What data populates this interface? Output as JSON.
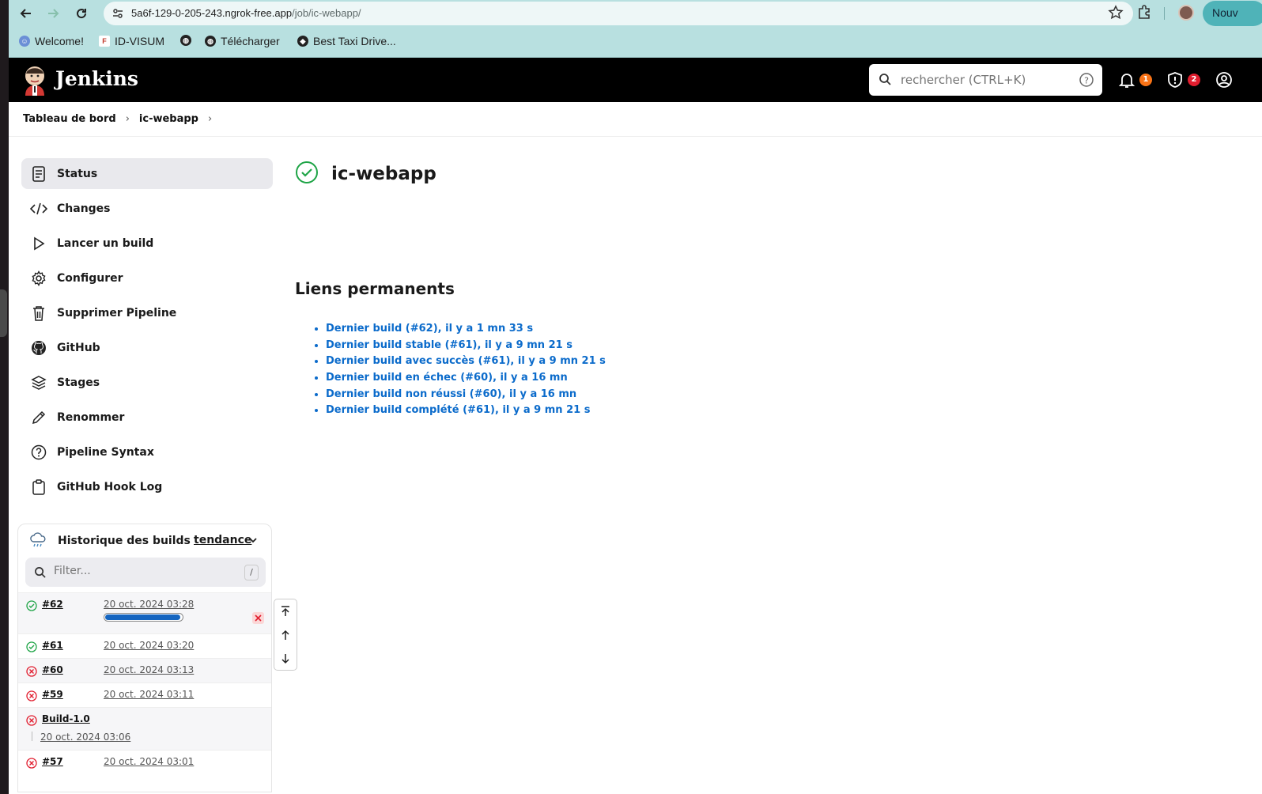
{
  "browser": {
    "url_host": "5a6f-129-0-205-243.ngrok-free.app",
    "url_path": "/job/ic-webapp/",
    "new_tab_label": "Nouv",
    "icons": [
      "back-icon",
      "forward-icon",
      "reload-icon",
      "site-info-icon",
      "star-icon",
      "extensions-icon"
    ]
  },
  "bookmarks": [
    {
      "label": "Welcome!",
      "icon": "welcome-icon"
    },
    {
      "label": "ID-VISUM",
      "icon": "idvisum-icon"
    },
    {
      "label": "",
      "icon": "globe-icon"
    },
    {
      "label": "Télécharger",
      "icon": "globe-icon"
    },
    {
      "label": "Best Taxi Drive...",
      "icon": "taxi-icon"
    }
  ],
  "header": {
    "title": "Jenkins",
    "search_placeholder": "rechercher (CTRL+K)",
    "notifications_count": "1",
    "security_count": "2",
    "colors": {
      "notif_badge": "#f97316",
      "security_badge": "#e11d2e"
    }
  },
  "breadcrumb": [
    "Tableau de bord",
    "ic-webapp"
  ],
  "sidebar": {
    "items": [
      {
        "label": "Status",
        "icon": "status-icon",
        "active": true
      },
      {
        "label": "Changes",
        "icon": "code-icon"
      },
      {
        "label": "Lancer un build",
        "icon": "play-icon"
      },
      {
        "label": "Configurer",
        "icon": "gear-icon"
      },
      {
        "label": "Supprimer Pipeline",
        "icon": "trash-icon"
      },
      {
        "label": "GitHub",
        "icon": "github-icon"
      },
      {
        "label": "Stages",
        "icon": "stages-icon"
      },
      {
        "label": "Renommer",
        "icon": "pencil-icon"
      },
      {
        "label": "Pipeline Syntax",
        "icon": "help-icon"
      },
      {
        "label": "GitHub Hook Log",
        "icon": "clipboard-icon"
      }
    ]
  },
  "history": {
    "title": "Historique des builds",
    "trend_label": "tendance",
    "filter_placeholder": "Filter...",
    "filter_shortcut": "/",
    "builds": [
      {
        "id": "#62",
        "date": "20 oct. 2024 03:28",
        "status": "success",
        "in_progress": true,
        "progress": 0.98
      },
      {
        "id": "#61",
        "date": "20 oct. 2024 03:20",
        "status": "success"
      },
      {
        "id": "#60",
        "date": "20 oct. 2024 03:13",
        "status": "failed"
      },
      {
        "id": "#59",
        "date": "20 oct. 2024 03:11",
        "status": "failed"
      },
      {
        "id": "Build-1.0",
        "date": "20 oct. 2024 03:06",
        "status": "failed",
        "multiline": true
      },
      {
        "id": "#57",
        "date": "20 oct. 2024 03:01",
        "status": "failed"
      }
    ],
    "colors": {
      "success": "#1ea446",
      "failed": "#e11d2e",
      "progress": "#1565c0"
    }
  },
  "main": {
    "job_name": "ic-webapp",
    "permalinks_title": "Liens permanents",
    "permalinks": [
      "Dernier build (#62), il y a 1 mn 33 s",
      "Dernier build stable (#61), il y a 9 mn 21 s",
      "Dernier build avec succès (#61), il y a 9 mn 21 s",
      "Dernier build en échec (#60), il y a 16 mn",
      "Dernier build non réussi (#60), il y a 16 mn",
      "Dernier build complété (#61), il y a 9 mn 21 s"
    ]
  }
}
